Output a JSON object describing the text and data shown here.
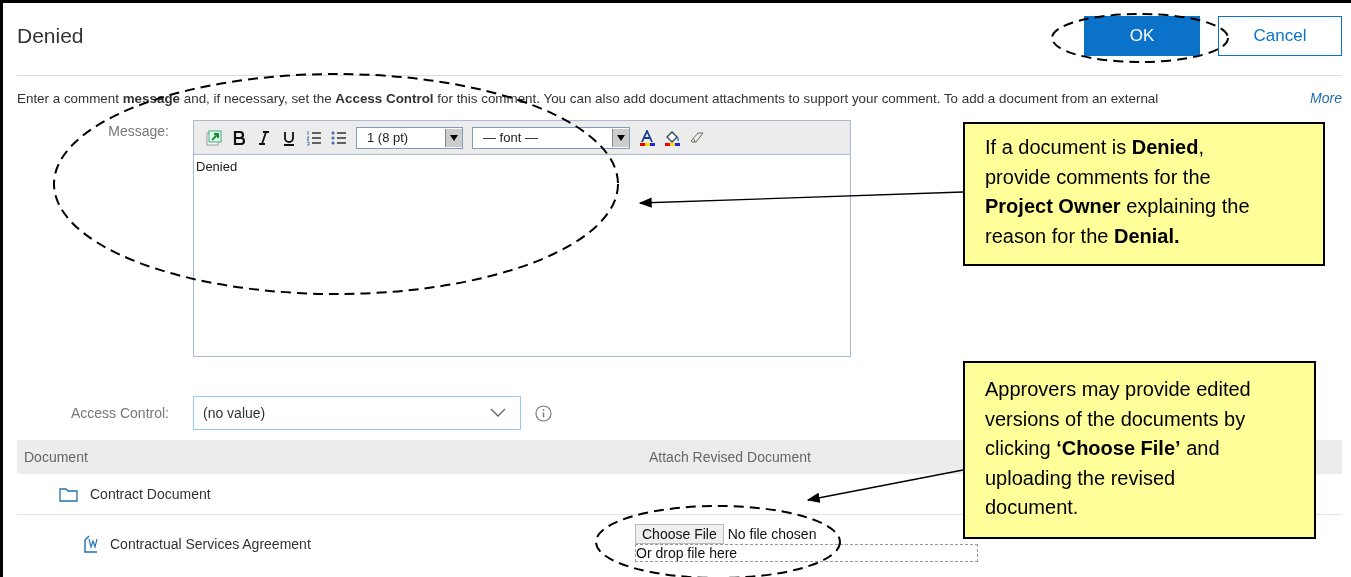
{
  "dialog": {
    "title": "Denied",
    "buttons": [
      {
        "label": "OK",
        "kind": "primary"
      },
      {
        "label": "Cancel",
        "kind": "secondary"
      }
    ]
  },
  "intro": {
    "text": "Enter a comment **message** and, if necessary, set the **Access Control** for this comment. You can also add document attachments to support your comment. To add a document from an external",
    "more": "More"
  },
  "message": {
    "label": "Message:",
    "font_size": "1 (8 pt)",
    "font": "— font —",
    "value": "Denied"
  },
  "access_control": {
    "label": "Access Control:",
    "value": "(no value)"
  },
  "table": {
    "columns": [
      "Document",
      "Attach Revised Document"
    ],
    "rows": [
      {
        "kind": "folder",
        "name": "Contract Document"
      },
      {
        "kind": "file",
        "name": "Contractual Services Agreement",
        "choose_button": "Choose File",
        "file_status": "No file chosen",
        "drop_hint": "Or drop file here"
      }
    ]
  },
  "callouts": [
    {
      "text": "If a document is **Denied**, provide comments for the **Project Owner** explaining the reason for the **Denial.**"
    },
    {
      "text": "Approvers may provide edited versions of the documents by clicking **‘Choose File’** and uploading the revised document."
    }
  ]
}
